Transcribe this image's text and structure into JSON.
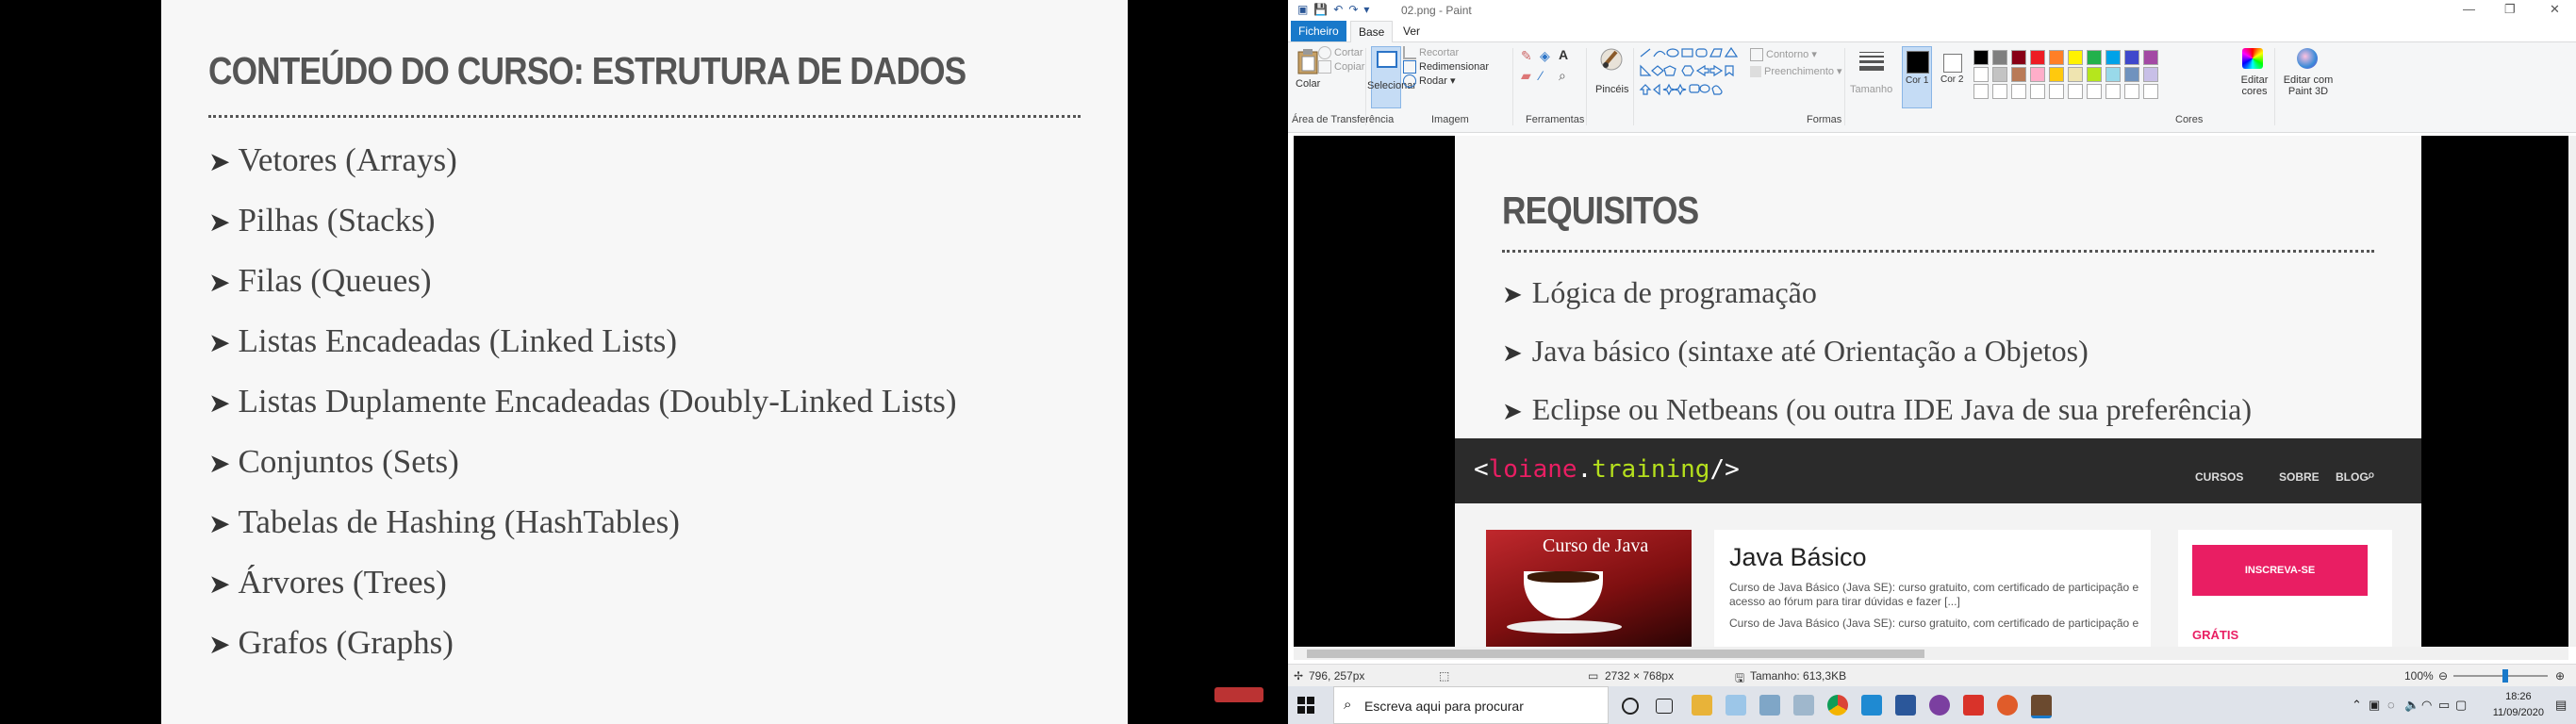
{
  "slide_left": {
    "title": "CONTEÚDO DO CURSO: ESTRUTURA DE DADOS",
    "bullet": "➤",
    "items": [
      "Vetores (Arrays)",
      "Pilhas (Stacks)",
      "Filas (Queues)",
      "Listas Encadeadas (Linked Lists)",
      "Listas Duplamente Encadeadas (Doubly-Linked Lists)",
      "Conjuntos (Sets)",
      "Tabelas de Hashing (HashTables)",
      "Árvores (Trees)",
      "Grafos (Graphs)"
    ]
  },
  "paint": {
    "window_title": "02.png - Paint",
    "menu": {
      "file": "Ficheiro",
      "home": "Base",
      "view": "Ver"
    },
    "ribbon": {
      "clipboard": {
        "paste": "Colar",
        "cut": "Cortar",
        "copy": "Copiar",
        "label": "Área de Transferência"
      },
      "image": {
        "select": "Selecionar",
        "crop": "Recortar",
        "resize": "Redimensionar",
        "rotate": "Rodar",
        "label": "Imagem"
      },
      "tools": {
        "label": "Ferramentas"
      },
      "brushes": "Pincéis",
      "shapes": {
        "outline": "Contorno",
        "fill": "Preenchimento",
        "label": "Formas"
      },
      "size": "Tamanho",
      "color1": "Cor 1",
      "color2": "Cor 2",
      "colors_label": "Cores",
      "edit_colors": "Editar cores",
      "paint3d": "Editar com Paint 3D",
      "palette": [
        "#000000",
        "#7f7f7f",
        "#880015",
        "#ed1c24",
        "#ff7f27",
        "#fff200",
        "#22b14c",
        "#00a2e8",
        "#3f48cc",
        "#a349a4",
        "#ffffff",
        "#c3c3c3",
        "#b97a57",
        "#ffaec9",
        "#ffc90e",
        "#efe4b0",
        "#b5e61d",
        "#99d9ea",
        "#7092be",
        "#c8bfe7"
      ]
    },
    "canvas_image": {
      "title": "REQUISITOS",
      "bullet": "➤",
      "items": [
        "Lógica de programação",
        "Java básico (sintaxe até Orientação a Objetos)",
        "Eclipse ou Netbeans (ou outra IDE Java de sua preferência)"
      ],
      "site": {
        "logo_open": "<",
        "logo_name": "loiane",
        "logo_dot": ".",
        "logo_training": "training",
        "logo_close": "/>",
        "nav": [
          "CURSOS",
          "SOBRE",
          "BLOG"
        ],
        "thumb_title": "Curso de Java",
        "card_title": "Java Básico",
        "card_text1": "Curso de Java Básico (Java SE): curso gratuito, com certificado de participação e acesso ao fórum para tirar dúvidas e fazer [...]",
        "card_text2": "Curso de Java Básico (Java SE): curso gratuito, com certificado de participação e",
        "subscribe": "INSCREVA-SE",
        "gratis": "GRÁTIS"
      }
    },
    "status": {
      "cursor": "796, 257px",
      "dimensions": "2732 × 768px",
      "size": "Tamanho: 613,3KB",
      "zoom": "100%"
    }
  },
  "taskbar": {
    "search_placeholder": "Escreva aqui para procurar",
    "time": "18:26",
    "date": "11/09/2020"
  }
}
